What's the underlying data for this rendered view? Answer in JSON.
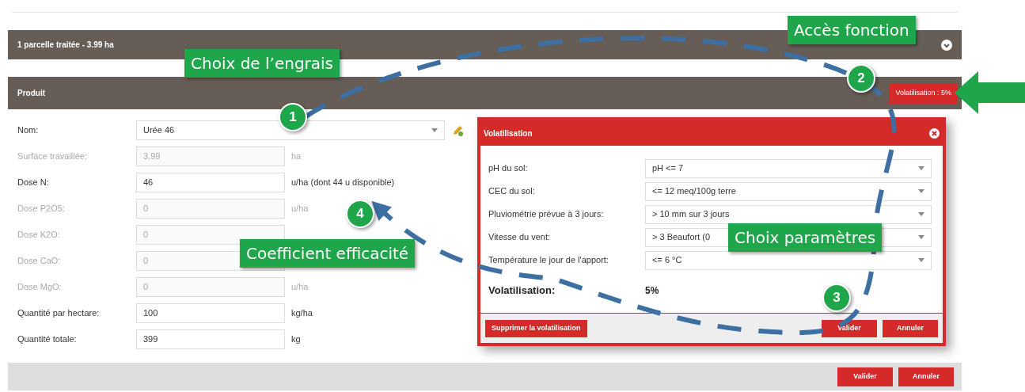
{
  "header_bar": {
    "title": "1 parcelle traitée - 3.99 ha"
  },
  "product_bar": {
    "title": "Produit",
    "badge": "Volatilisation : 5%"
  },
  "form": {
    "rows": [
      {
        "kind": "select",
        "label": "Nom:",
        "value": "Urée 46",
        "disabled": false
      },
      {
        "kind": "input",
        "label": "Surface travaillée:",
        "value": "3.99",
        "unit": "ha",
        "disabled": true
      },
      {
        "kind": "input",
        "label": "Dose N:",
        "value": "46",
        "unit": "u/ha (dont 44 u disponible)",
        "disabled": false
      },
      {
        "kind": "input",
        "label": "Dose P2O5:",
        "value": "0",
        "unit": "u/ha",
        "disabled": true
      },
      {
        "kind": "input",
        "label": "Dose K2O:",
        "value": "0",
        "disabled": true
      },
      {
        "kind": "input",
        "label": "Dose CaO:",
        "value": "0",
        "disabled": true
      },
      {
        "kind": "input",
        "label": "Dose MgO:",
        "value": "0",
        "unit": "u/ha",
        "disabled": true
      },
      {
        "kind": "input",
        "label": "Quantité par hectare:",
        "value": "100",
        "unit": "kg/ha",
        "disabled": false
      },
      {
        "kind": "input",
        "label": "Quantité totale:",
        "value": "399",
        "unit": "kg",
        "disabled": false
      }
    ]
  },
  "dialog": {
    "title": "Volatilisation",
    "fields": [
      {
        "label": "pH du sol:",
        "value": "pH <= 7"
      },
      {
        "label": "CEC du sol:",
        "value": "<= 12 meq/100g terre"
      },
      {
        "label": "Pluviométrie prévue à 3 jours:",
        "value": "> 10 mm sur 3 jours"
      },
      {
        "label": "Vitesse du vent:",
        "value": "> 3 Beaufort (0"
      },
      {
        "label": "Température le jour de l'apport:",
        "value": "<= 6 °C"
      }
    ],
    "result_label": "Volatilisation:",
    "result_value": "5%",
    "delete_button": "Supprimer la volatilisation",
    "buttons": [
      "Valider",
      "Annuler"
    ]
  },
  "footer": {
    "buttons": [
      "Valider",
      "Annuler"
    ]
  },
  "annotations": {
    "callouts": [
      "Accès fonction",
      "Choix de l’engrais",
      "Choix paramètres",
      "Coefficient efficacité"
    ],
    "steps": [
      "1",
      "2",
      "3",
      "4"
    ]
  }
}
